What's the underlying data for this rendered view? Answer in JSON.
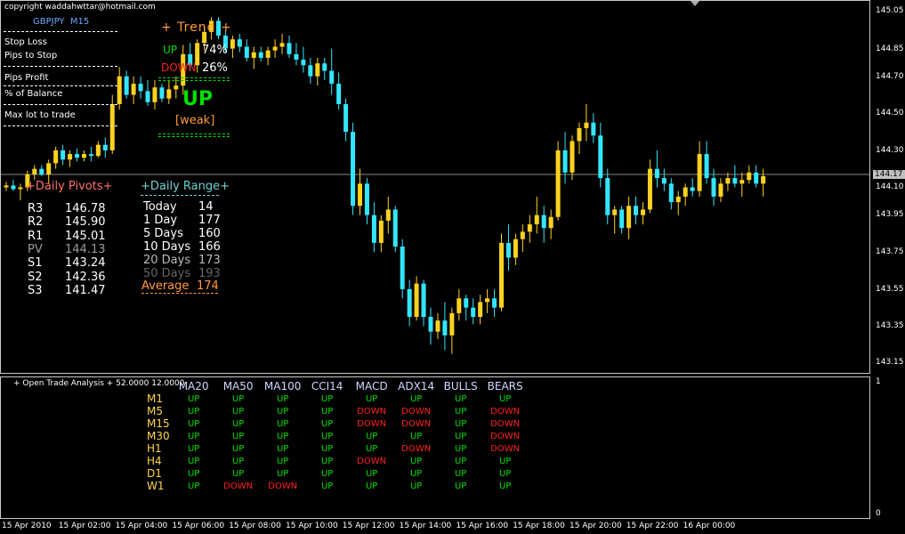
{
  "copyright": "copyright waddahwttar@hotmail.com",
  "symbol": "GBPJPY",
  "timeframe": "M15",
  "info_labels": [
    "Stop Loss",
    "Pips to Stop",
    "Pips Profit",
    "% of Balance",
    "Max lot to trade"
  ],
  "trend": {
    "header": "+ Trend +",
    "up_label": "UP",
    "up_pct": "74%",
    "down_label": "DOWN",
    "down_pct": "26%",
    "main": "UP",
    "strength": "[weak]"
  },
  "pivots": {
    "title": "+Daily Pivots+",
    "rows": [
      {
        "name": "R3",
        "value": "146.78",
        "color": "#ffffff"
      },
      {
        "name": "R2",
        "value": "145.90",
        "color": "#ffffff"
      },
      {
        "name": "R1",
        "value": "145.01",
        "color": "#ffffff"
      },
      {
        "name": "PV",
        "value": "144.13",
        "color": "#9a9a9a"
      },
      {
        "name": "S1",
        "value": "143.24",
        "color": "#ffffff"
      },
      {
        "name": "S2",
        "value": "142.36",
        "color": "#ffffff"
      },
      {
        "name": "S3",
        "value": "141.47",
        "color": "#ffffff"
      }
    ]
  },
  "range": {
    "title": "+Daily Range+",
    "rows": [
      {
        "name": "Today",
        "value": "14",
        "color": "#ffffff"
      },
      {
        "name": "1 Day",
        "value": "177",
        "color": "#ffffff"
      },
      {
        "name": "5 Days",
        "value": "160",
        "color": "#ffffff"
      },
      {
        "name": "10 Days",
        "value": "166",
        "color": "#ffffff"
      },
      {
        "name": "20 Days",
        "value": "173",
        "color": "#bbbbbb"
      },
      {
        "name": "50 Days",
        "value": "193",
        "color": "#666666"
      },
      {
        "name": "Average",
        "value": "174",
        "color": "#ff9a3c"
      }
    ]
  },
  "price_axis": [
    "145.05",
    "144.85",
    "144.70",
    "144.50",
    "144.30",
    "144.10",
    "143.95",
    "143.75",
    "143.55",
    "143.35",
    "143.15"
  ],
  "current_price": "144.17",
  "time_axis": [
    "15 Apr 2010",
    "15 Apr 02:00",
    "15 Apr 04:00",
    "15 Apr 06:00",
    "15 Apr 08:00",
    "15 Apr 10:00",
    "15 Apr 12:00",
    "15 Apr 14:00",
    "15 Apr 16:00",
    "15 Apr 18:00",
    "15 Apr 20:00",
    "15 Apr 22:00",
    "16 Apr 00:00"
  ],
  "sub_axis": [
    "1",
    "0"
  ],
  "analysis": {
    "title": "+ Open Trade Analysis + 52.0000 12.0000",
    "columns": [
      "MA20",
      "MA50",
      "MA100",
      "CCI14",
      "MACD",
      "ADX14",
      "BULLS",
      "BEARS"
    ],
    "rows": [
      {
        "tf": "M1",
        "cells": [
          "UP",
          "UP",
          "UP",
          "UP",
          "UP",
          "UP",
          "UP",
          "UP"
        ]
      },
      {
        "tf": "M5",
        "cells": [
          "UP",
          "UP",
          "UP",
          "UP",
          "DOWN",
          "DOWN",
          "UP",
          "DOWN"
        ]
      },
      {
        "tf": "M15",
        "cells": [
          "UP",
          "UP",
          "UP",
          "UP",
          "DOWN",
          "DOWN",
          "UP",
          "DOWN"
        ]
      },
      {
        "tf": "M30",
        "cells": [
          "UP",
          "UP",
          "UP",
          "UP",
          "UP",
          "UP",
          "UP",
          "DOWN"
        ]
      },
      {
        "tf": "H1",
        "cells": [
          "UP",
          "UP",
          "UP",
          "UP",
          "UP",
          "DOWN",
          "UP",
          "DOWN"
        ]
      },
      {
        "tf": "H4",
        "cells": [
          "UP",
          "UP",
          "UP",
          "UP",
          "DOWN",
          "UP",
          "UP",
          "UP"
        ]
      },
      {
        "tf": "D1",
        "cells": [
          "UP",
          "UP",
          "UP",
          "UP",
          "UP",
          "UP",
          "UP",
          "UP"
        ]
      },
      {
        "tf": "W1",
        "cells": [
          "UP",
          "DOWN",
          "DOWN",
          "UP",
          "UP",
          "UP",
          "UP",
          "UP"
        ]
      }
    ]
  },
  "colors": {
    "bull": "#ffd21f",
    "bear": "#33e6ff",
    "up": "#00e000",
    "down": "#ff2020",
    "trend_header": "#ff9a3c",
    "daily_pivots_title": "#ff6f6f",
    "daily_range_title": "#6fd0d0"
  },
  "candles": [
    [
      144.1,
      144.13,
      144.08,
      144.11
    ],
    [
      144.11,
      144.14,
      144.08,
      144.09
    ],
    [
      144.09,
      144.12,
      144.03,
      144.1
    ],
    [
      144.1,
      144.19,
      144.08,
      144.17
    ],
    [
      144.17,
      144.22,
      144.14,
      144.2
    ],
    [
      144.2,
      144.22,
      144.16,
      144.17
    ],
    [
      144.17,
      144.25,
      144.12,
      144.23
    ],
    [
      144.23,
      144.32,
      144.2,
      144.3
    ],
    [
      144.3,
      144.33,
      144.22,
      144.25
    ],
    [
      144.25,
      144.3,
      144.21,
      144.28
    ],
    [
      144.28,
      144.31,
      144.24,
      144.26
    ],
    [
      144.26,
      144.3,
      144.24,
      144.28
    ],
    [
      144.28,
      144.32,
      144.24,
      144.27
    ],
    [
      144.27,
      144.35,
      144.26,
      144.33
    ],
    [
      144.33,
      144.37,
      144.26,
      144.3
    ],
    [
      144.3,
      144.6,
      144.28,
      144.55
    ],
    [
      144.55,
      144.75,
      144.52,
      144.7
    ],
    [
      144.7,
      144.73,
      144.58,
      144.6
    ],
    [
      144.6,
      144.7,
      144.55,
      144.66
    ],
    [
      144.66,
      144.7,
      144.58,
      144.62
    ],
    [
      144.62,
      144.68,
      144.54,
      144.56
    ],
    [
      144.56,
      144.68,
      144.52,
      144.64
    ],
    [
      144.64,
      144.66,
      144.56,
      144.58
    ],
    [
      144.58,
      144.68,
      144.55,
      144.63
    ],
    [
      144.63,
      144.7,
      144.58,
      144.65
    ],
    [
      144.65,
      144.87,
      144.6,
      144.82
    ],
    [
      144.82,
      144.88,
      144.73,
      144.76
    ],
    [
      144.76,
      144.9,
      144.72,
      144.88
    ],
    [
      144.88,
      144.98,
      144.84,
      144.94
    ],
    [
      144.94,
      145.02,
      144.9,
      145.0
    ],
    [
      145.0,
      145.02,
      144.9,
      144.92
    ],
    [
      144.92,
      144.95,
      144.83,
      144.85
    ],
    [
      144.85,
      144.92,
      144.8,
      144.9
    ],
    [
      144.9,
      144.93,
      144.83,
      144.86
    ],
    [
      144.86,
      144.9,
      144.78,
      144.8
    ],
    [
      144.8,
      144.86,
      144.74,
      144.83
    ],
    [
      144.83,
      144.86,
      144.78,
      144.8
    ],
    [
      144.8,
      144.86,
      144.76,
      144.84
    ],
    [
      144.84,
      144.9,
      144.8,
      144.86
    ],
    [
      144.86,
      144.93,
      144.82,
      144.88
    ],
    [
      144.88,
      144.92,
      144.8,
      144.82
    ],
    [
      144.82,
      144.88,
      144.76,
      144.79
    ],
    [
      144.79,
      144.86,
      144.72,
      144.76
    ],
    [
      144.76,
      144.8,
      144.66,
      144.7
    ],
    [
      144.7,
      144.8,
      144.65,
      144.77
    ],
    [
      144.77,
      144.8,
      144.68,
      144.73
    ],
    [
      144.73,
      144.85,
      144.6,
      144.66
    ],
    [
      144.66,
      144.72,
      144.52,
      144.55
    ],
    [
      144.55,
      144.58,
      144.35,
      144.4
    ],
    [
      144.4,
      144.45,
      143.95,
      144.0
    ],
    [
      144.0,
      144.2,
      143.95,
      144.12
    ],
    [
      144.12,
      144.15,
      143.9,
      143.95
    ],
    [
      143.95,
      144.02,
      143.75,
      143.8
    ],
    [
      143.8,
      143.95,
      143.75,
      143.92
    ],
    [
      143.92,
      144.05,
      143.85,
      143.98
    ],
    [
      143.98,
      144.0,
      143.75,
      143.78
    ],
    [
      143.78,
      143.82,
      143.5,
      143.55
    ],
    [
      143.55,
      143.6,
      143.35,
      143.4
    ],
    [
      143.4,
      143.62,
      143.38,
      143.58
    ],
    [
      143.58,
      143.6,
      143.35,
      143.4
    ],
    [
      143.4,
      143.45,
      143.25,
      143.32
    ],
    [
      143.32,
      143.42,
      143.28,
      143.38
    ],
    [
      143.38,
      143.48,
      143.22,
      143.3
    ],
    [
      143.3,
      143.45,
      143.2,
      143.42
    ],
    [
      143.42,
      143.55,
      143.38,
      143.5
    ],
    [
      143.5,
      143.52,
      143.38,
      143.45
    ],
    [
      143.45,
      143.5,
      143.36,
      143.4
    ],
    [
      143.4,
      143.52,
      143.36,
      143.48
    ],
    [
      143.48,
      143.55,
      143.42,
      143.5
    ],
    [
      143.5,
      143.55,
      143.4,
      143.45
    ],
    [
      143.45,
      143.85,
      143.43,
      143.8
    ],
    [
      143.8,
      143.9,
      143.65,
      143.72
    ],
    [
      143.72,
      143.85,
      143.68,
      143.82
    ],
    [
      143.82,
      143.9,
      143.75,
      143.86
    ],
    [
      143.86,
      143.95,
      143.8,
      143.9
    ],
    [
      143.9,
      144.05,
      143.85,
      143.95
    ],
    [
      143.95,
      144.0,
      143.8,
      143.88
    ],
    [
      143.88,
      143.98,
      143.82,
      143.94
    ],
    [
      143.94,
      144.35,
      143.92,
      144.3
    ],
    [
      144.3,
      144.4,
      144.12,
      144.18
    ],
    [
      144.18,
      144.38,
      144.14,
      144.35
    ],
    [
      144.35,
      144.45,
      144.28,
      144.42
    ],
    [
      144.42,
      144.55,
      144.35,
      144.45
    ],
    [
      144.45,
      144.5,
      144.34,
      144.38
    ],
    [
      144.38,
      144.45,
      144.1,
      144.15
    ],
    [
      144.15,
      144.2,
      143.9,
      143.95
    ],
    [
      143.95,
      144.0,
      143.85,
      143.98
    ],
    [
      143.98,
      144.0,
      143.85,
      143.88
    ],
    [
      143.88,
      144.05,
      143.82,
      144.0
    ],
    [
      144.0,
      144.05,
      143.9,
      143.95
    ],
    [
      143.95,
      144.02,
      143.9,
      143.98
    ],
    [
      143.98,
      144.25,
      143.96,
      144.2
    ],
    [
      144.2,
      144.3,
      144.1,
      144.15
    ],
    [
      144.15,
      144.2,
      144.08,
      144.12
    ],
    [
      144.12,
      144.15,
      143.98,
      144.02
    ],
    [
      144.02,
      144.08,
      143.95,
      144.05
    ],
    [
      144.05,
      144.12,
      144.0,
      144.1
    ],
    [
      144.1,
      144.15,
      144.05,
      144.08
    ],
    [
      144.08,
      144.35,
      144.05,
      144.28
    ],
    [
      144.28,
      144.35,
      144.12,
      144.15
    ],
    [
      144.15,
      144.2,
      144.0,
      144.05
    ],
    [
      144.05,
      144.15,
      144.02,
      144.12
    ],
    [
      144.12,
      144.18,
      144.08,
      144.15
    ],
    [
      144.15,
      144.22,
      144.1,
      144.12
    ],
    [
      144.12,
      144.18,
      144.05,
      144.14
    ],
    [
      144.14,
      144.22,
      144.12,
      144.18
    ],
    [
      144.18,
      144.22,
      144.1,
      144.12
    ],
    [
      144.12,
      144.2,
      144.05,
      144.16
    ]
  ]
}
